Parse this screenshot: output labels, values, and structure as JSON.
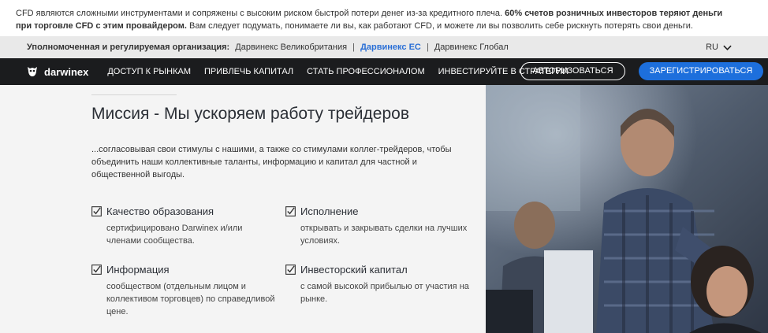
{
  "risk": {
    "text1": "CFD являются сложными инструментами и сопряжены с высоким риском быстрой потери денег из-за кредитного плеча.",
    "bold1": "60% счетов розничных инвесторов теряют деньги при торговле CFD с этим провайдером.",
    "text2": "Вам следует подумать, понимаете ли вы, как работают CFD, и можете ли вы позволить себе рискнуть потерять свои деньги."
  },
  "regulation": {
    "title": "Уполномоченная и регулируемая организация:",
    "entities": [
      "Дарвинекс Великобритания",
      "Дарвинекс ЕС",
      "Дарвинекс Глобал"
    ],
    "separator": "|",
    "language": "RU"
  },
  "nav": {
    "brand": "darwinex",
    "items": [
      "ДОСТУП К РЫНКАМ",
      "ПРИВЛЕЧЬ КАПИТАЛ",
      "СТАТЬ ПРОФЕССИОНАЛОМ",
      "ИНВЕСТИРУЙТЕ В СТРАТЕГИИ"
    ],
    "login": "АВТОРИЗОВАТЬСЯ",
    "register": "ЗАРЕГИСТРИРОВАТЬСЯ"
  },
  "main": {
    "heading": "Миссия - Мы ускоряем работу трейдеров",
    "intro": "...согласовывая свои стимулы с нашими, а также со стимулами коллег-трейдеров, чтобы объединить наши коллективные таланты, информацию и капитал для частной и общественной выгоды.",
    "features": [
      {
        "title": "Качество образования",
        "desc": "сертифицировано Darwinex и/или членами сообщества."
      },
      {
        "title": "Исполнение",
        "desc": "открывать и закрывать сделки на лучших условиях."
      },
      {
        "title": "Информация",
        "desc": "сообществом (отдельным лицом и коллективом торговцев) по справедливой цене."
      },
      {
        "title": "Инвесторский капитал",
        "desc": "с самой высокой прибылью от участия на рынке."
      }
    ]
  },
  "colors": {
    "accent": "#1d6fdc",
    "navbar": "#1b1c1e",
    "reg_bar": "#e9e9e9",
    "content_bg": "#f4f4f4"
  }
}
